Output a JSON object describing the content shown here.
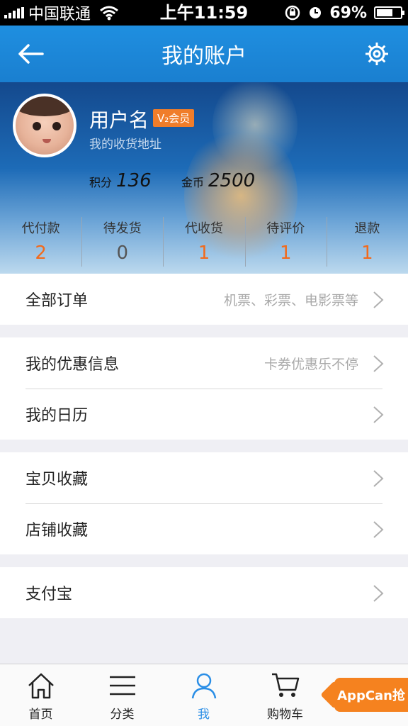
{
  "status_bar": {
    "carrier": "中国联通",
    "time": "上午11:59",
    "battery": "69%",
    "battery_level": 0.69
  },
  "nav": {
    "title": "我的账户"
  },
  "profile": {
    "username": "用户名",
    "vip_badge": "V₂会员",
    "address_link": "我的收货地址",
    "points_label": "积分",
    "points_value": "136",
    "coins_label": "金币",
    "coins_value": "2500"
  },
  "orders": [
    {
      "label": "代付款",
      "count": "2"
    },
    {
      "label": "待发货",
      "count": "0"
    },
    {
      "label": "代收货",
      "count": "1"
    },
    {
      "label": "待评价",
      "count": "1"
    },
    {
      "label": "退款",
      "count": "1"
    }
  ],
  "menu": {
    "all_orders": {
      "label": "全部订单",
      "hint": "机票、彩票、电影票等"
    },
    "coupons": {
      "label": "我的优惠信息",
      "hint": "卡券优惠乐不停"
    },
    "calendar": {
      "label": "我的日历"
    },
    "fav_items": {
      "label": "宝贝收藏"
    },
    "fav_shops": {
      "label": "店铺收藏"
    },
    "alipay": {
      "label": "支付宝"
    }
  },
  "tabs": [
    {
      "label": "首页",
      "icon": "home-icon"
    },
    {
      "label": "分类",
      "icon": "menu-icon"
    },
    {
      "label": "我",
      "icon": "person-icon"
    },
    {
      "label": "购物车",
      "icon": "cart-icon"
    }
  ],
  "floating_badge": "AppCan抢",
  "colors": {
    "nav_blue": "#1f8fe0",
    "accent_orange": "#f26a1b",
    "tab_active": "#2a8ee6"
  }
}
